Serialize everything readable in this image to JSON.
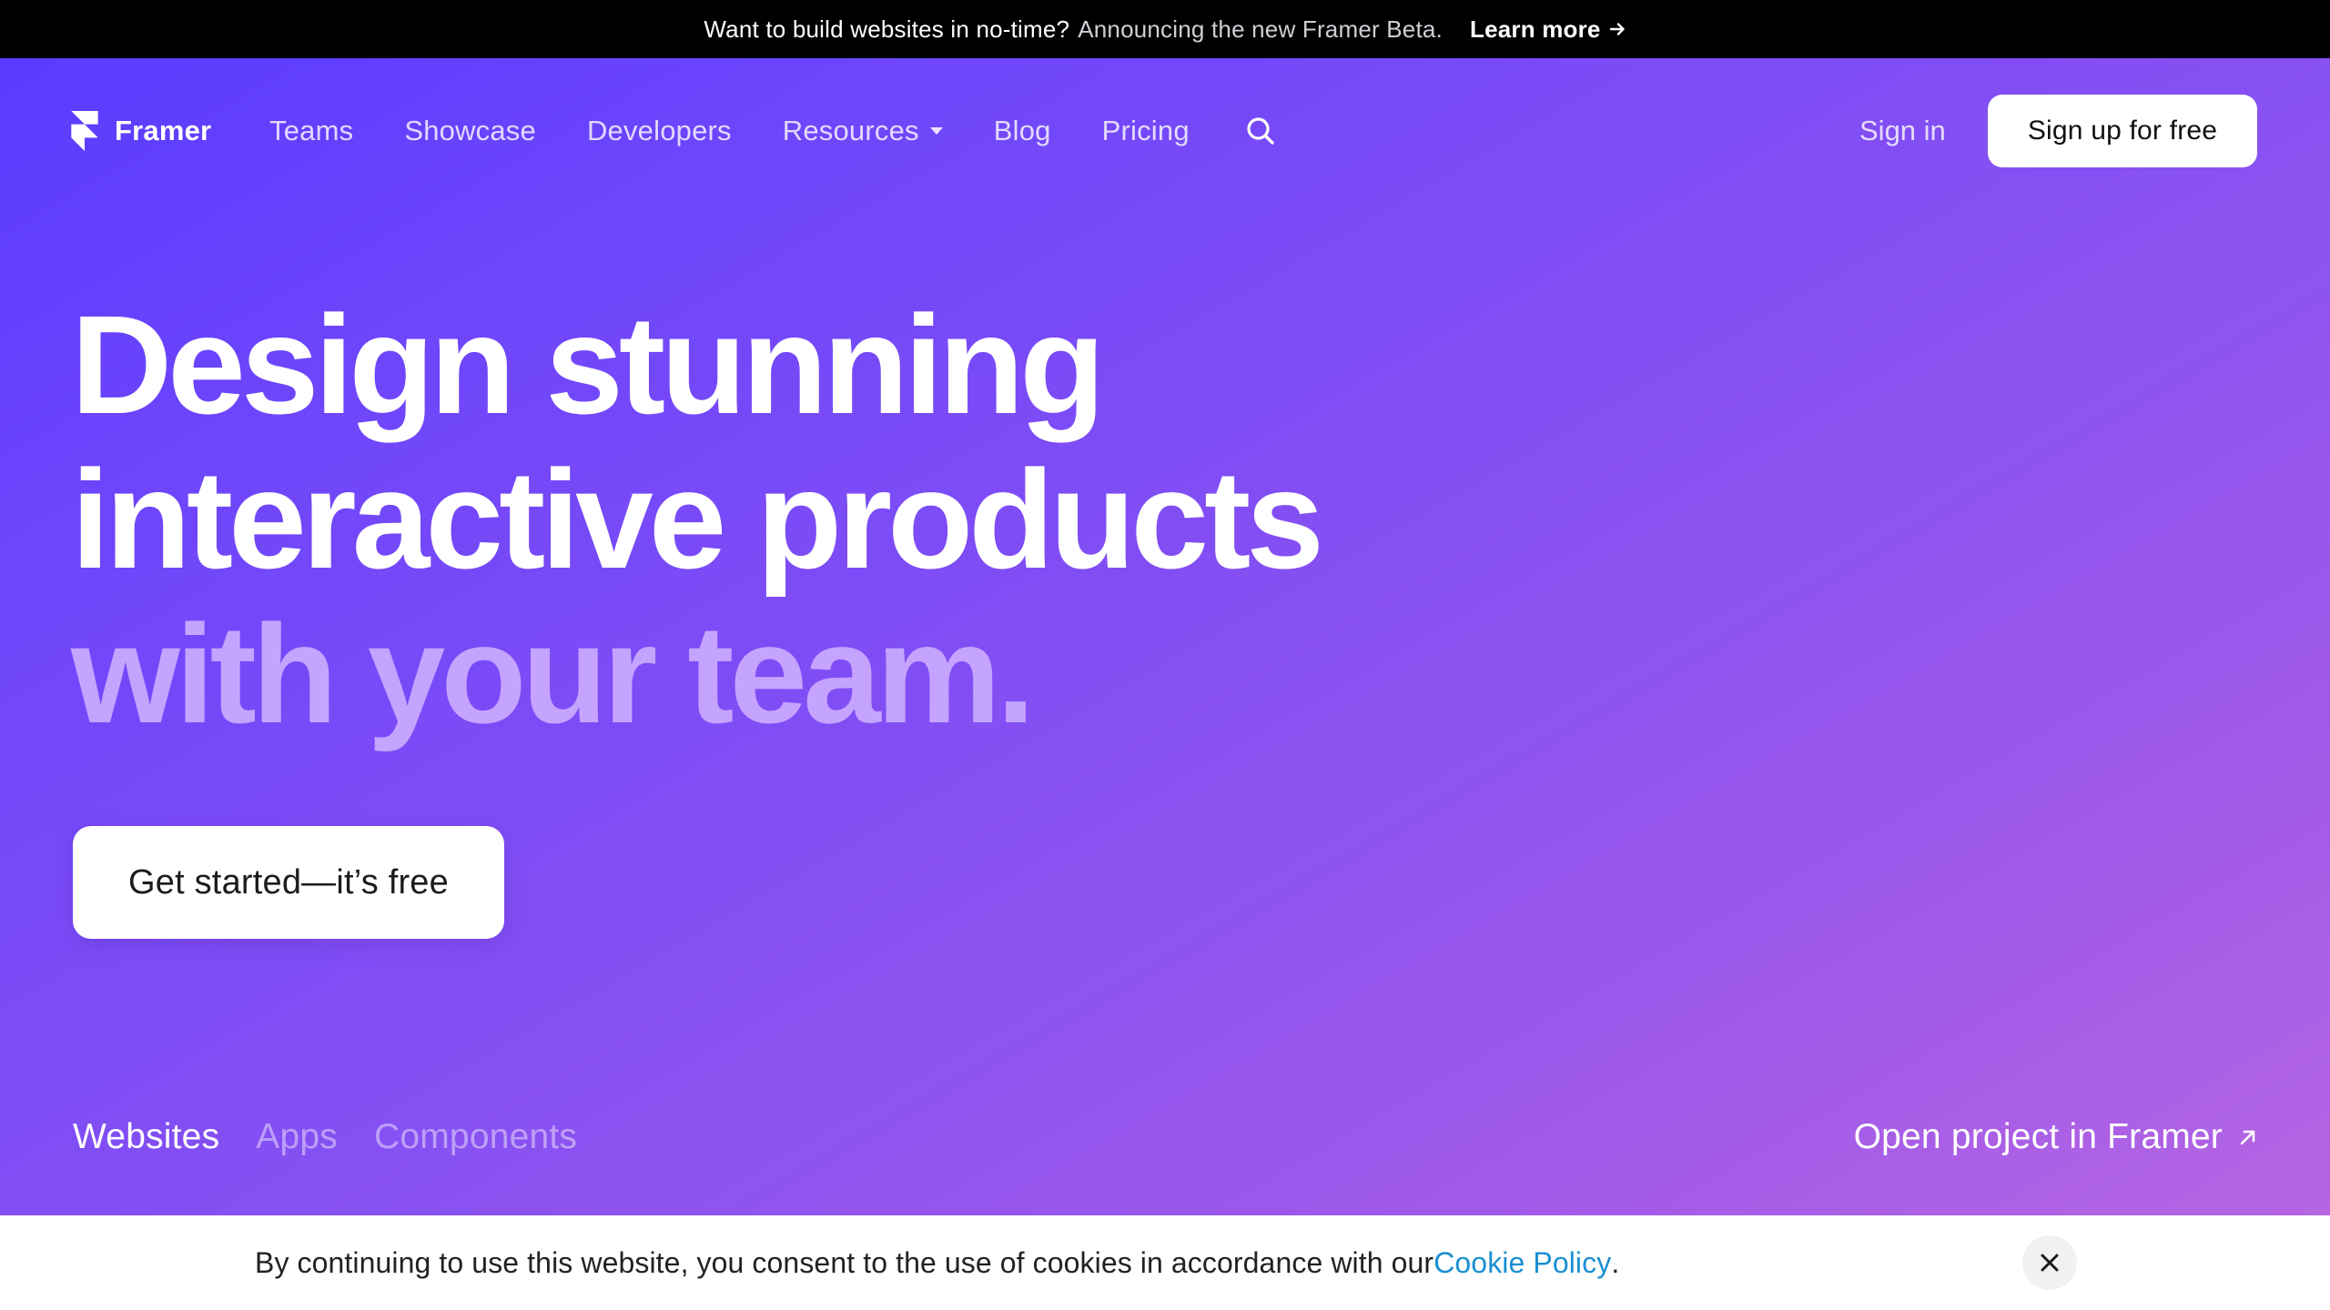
{
  "announcement": {
    "question": "Want to build websites in no-time?",
    "subtext": "Announcing the new Framer Beta.",
    "link_label": "Learn more"
  },
  "nav": {
    "brand": "Framer",
    "links": [
      "Teams",
      "Showcase",
      "Developers",
      "Resources",
      "Blog",
      "Pricing"
    ],
    "sign_in": "Sign in",
    "sign_up": "Sign up for free"
  },
  "hero": {
    "line1": "Design stunning",
    "line2": "interactive products",
    "line3": "with your team.",
    "cta": "Get started—it’s free"
  },
  "tabs": {
    "items": [
      "Websites",
      "Apps",
      "Components"
    ],
    "active": "Websites",
    "open_project": "Open project in Framer"
  },
  "cookie": {
    "text_before": "By continuing to use this website, you consent to the use of cookies in accordance with our ",
    "link": "Cookie Policy",
    "text_after": "."
  },
  "colors": {
    "gradient_start": "#5a3bff",
    "gradient_end": "#b565e2",
    "headline_accent": "#c4a4ff",
    "cookie_link": "#1a8fd1"
  },
  "icons": [
    "framer-logo-icon",
    "chevron-down-icon",
    "search-icon",
    "arrow-right-icon",
    "arrow-up-right-icon",
    "close-icon"
  ]
}
